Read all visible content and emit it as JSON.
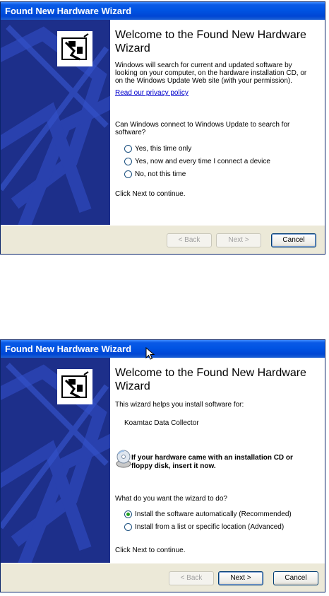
{
  "window1": {
    "title": "Found New Hardware Wizard",
    "heading": "Welcome to the Found New Hardware Wizard",
    "intro": "Windows will search for current and updated software by looking on your computer, on the hardware installation CD, or on the Windows Update Web site (with your permission).",
    "privacy_link": "Read our privacy policy",
    "question": "Can Windows connect to Windows Update to search for software?",
    "options": [
      "Yes, this time only",
      "Yes, now and every time I connect a device",
      "No, not this time"
    ],
    "continue_text": "Click Next to continue.",
    "back_label": "< Back",
    "next_label": "Next >",
    "cancel_label": "Cancel"
  },
  "window2": {
    "title": "Found New Hardware Wizard",
    "heading": "Welcome to the Found New Hardware Wizard",
    "intro": "This wizard helps you install software for:",
    "device": "Koamtac Data Collector",
    "cd_note": "If your hardware came with an installation CD or floppy disk, insert it now.",
    "question": "What do you want the wizard to do?",
    "options": [
      "Install the software automatically (Recommended)",
      "Install from a list or specific location (Advanced)"
    ],
    "selected_option": 0,
    "continue_text": "Click Next to continue.",
    "back_label": "< Back",
    "next_label": "Next >",
    "cancel_label": "Cancel"
  },
  "colors": {
    "title_bar": "#0054e3",
    "sidebar": "#1d2f8a",
    "dialog_bg": "#ece9d8"
  },
  "icons": [
    "hardware-icon",
    "cd-icon",
    "mouse-cursor-icon"
  ]
}
